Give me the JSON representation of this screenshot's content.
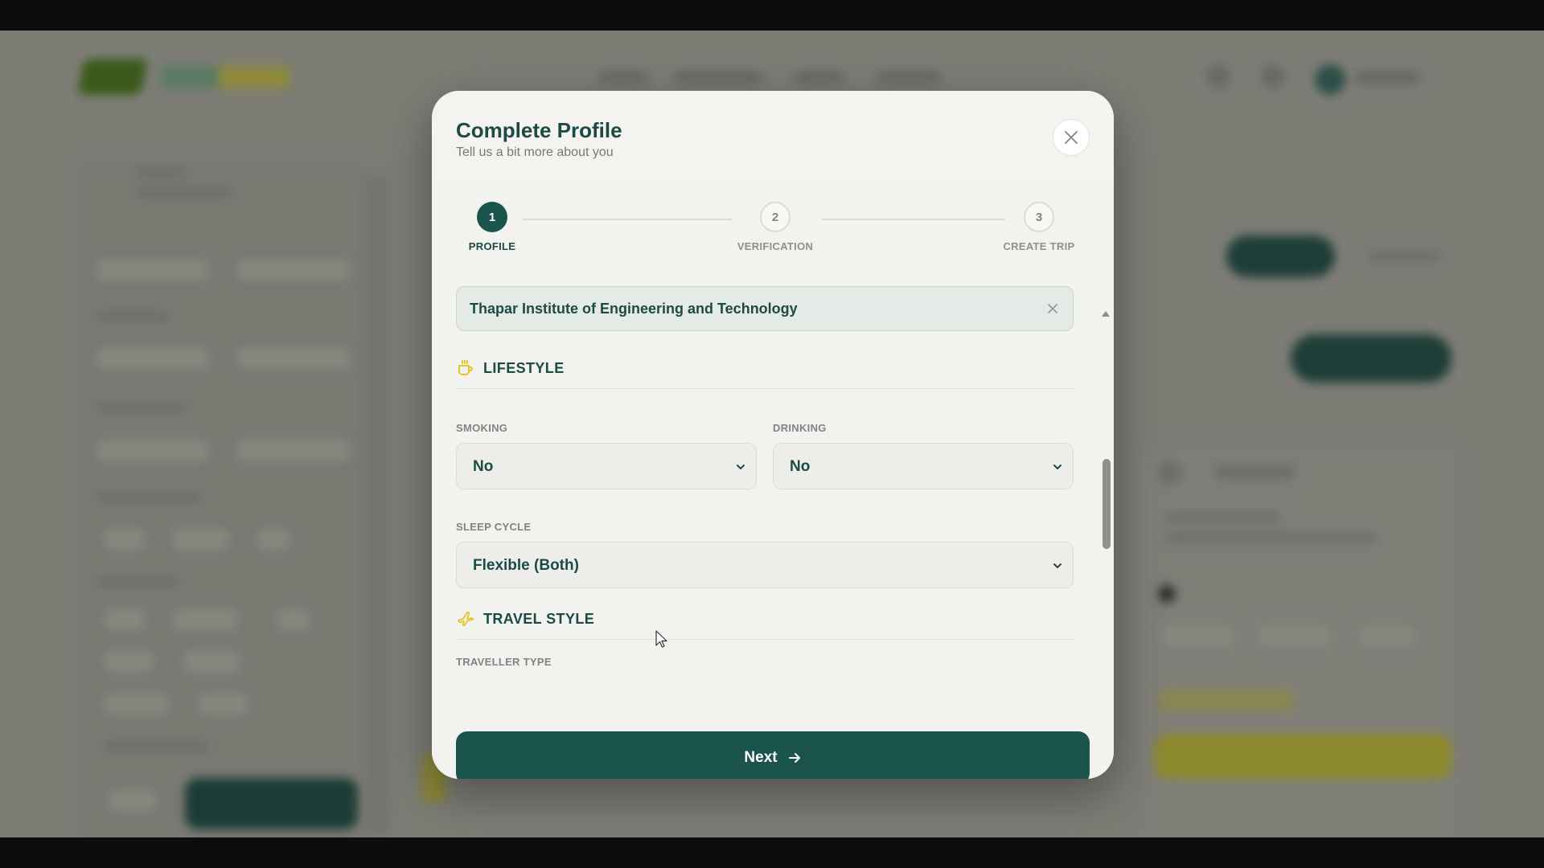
{
  "modal": {
    "title": "Complete Profile",
    "subtitle": "Tell us a bit more about you"
  },
  "stepper": {
    "steps": [
      {
        "number": "1",
        "label": "PROFILE",
        "state": "active"
      },
      {
        "number": "2",
        "label": "VERIFICATION",
        "state": "inactive"
      },
      {
        "number": "3",
        "label": "CREATE TRIP",
        "state": "inactive"
      }
    ]
  },
  "institution": {
    "value": "Thapar Institute of Engineering and Technology"
  },
  "lifestyle": {
    "heading": "LIFESTYLE",
    "smoking": {
      "label": "SMOKING",
      "value": "No"
    },
    "drinking": {
      "label": "DRINKING",
      "value": "No"
    },
    "sleep_cycle": {
      "label": "SLEEP CYCLE",
      "value": "Flexible (Both)"
    }
  },
  "travel_style": {
    "heading": "TRAVEL STYLE",
    "traveller_type": {
      "label": "TRAVELLER TYPE"
    }
  },
  "footer": {
    "next_label": "Next"
  },
  "colors": {
    "primary": "#1b534d",
    "accent_yellow": "#e3c62b",
    "overlay": "#7d7d76"
  }
}
